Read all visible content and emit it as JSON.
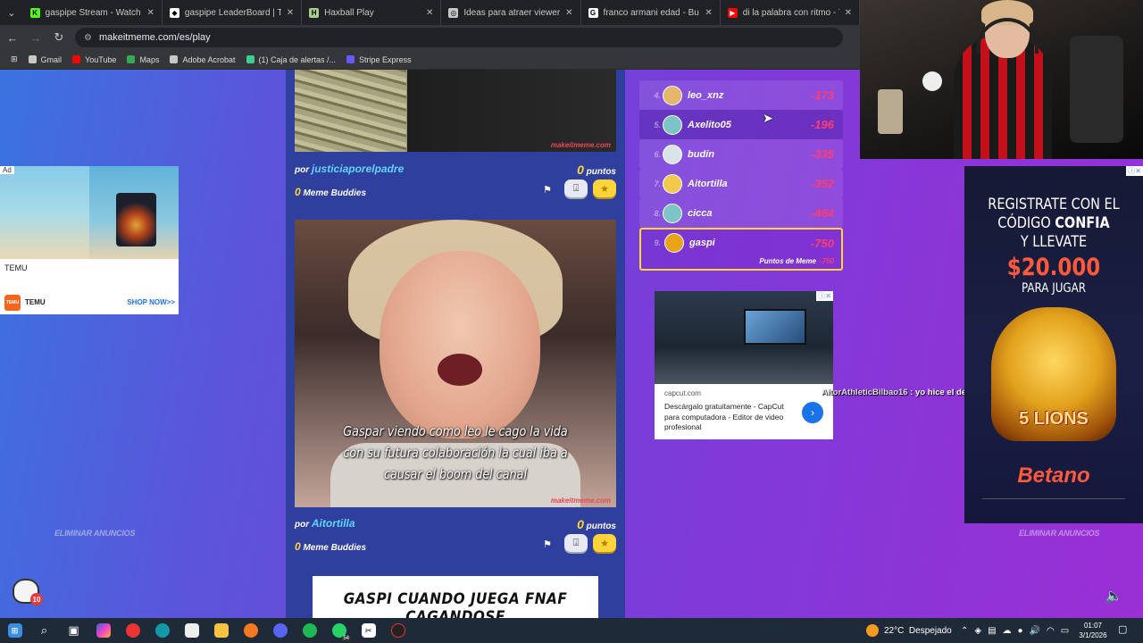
{
  "tabs": [
    {
      "label": "gaspipe Stream - Watch Live on",
      "color": "#53fc18",
      "glyph": "K",
      "active": false
    },
    {
      "label": "gaspipe LeaderBoard | The best",
      "color": "#ffffff",
      "glyph": "◆",
      "active": false
    },
    {
      "label": "Haxball Play",
      "color": "#a7cf8b",
      "glyph": "H",
      "active": false
    },
    {
      "label": "Ideas para atraer viewers",
      "color": "#c8c8c8",
      "glyph": "◎",
      "active": false
    },
    {
      "label": "franco armani edad - Buscar con",
      "color": "#ffffff",
      "glyph": "G",
      "active": false
    },
    {
      "label": "di la palabra con ritmo - YouTu",
      "color": "#ff0000",
      "glyph": "▶",
      "active": false
    }
  ],
  "address": {
    "url": "makeitmeme.com/es/play"
  },
  "bookmarks": [
    {
      "label": "Gmail",
      "color": "#c8c8c8"
    },
    {
      "label": "YouTube",
      "color": "#ff0000"
    },
    {
      "label": "Maps",
      "color": "#34a853"
    },
    {
      "label": "Adobe Acrobat",
      "color": "#c8c8c8"
    },
    {
      "label": "(1) Caja de alertas /...",
      "color": "#3ccf91"
    },
    {
      "label": "Stripe Express",
      "color": "#635bff"
    }
  ],
  "feed": {
    "post1": {
      "by_prefix": "por",
      "author": "justiciaporelpadre",
      "points": "0",
      "points_label": "puntos",
      "buddies": "0",
      "buddies_label": "Meme Buddies",
      "watermark": "makeitmeme.com"
    },
    "post2": {
      "caption": "Gaspar viendo como leo le cago la vida con su futura colaboración la cual iba a causar el boom del canal",
      "by_prefix": "por",
      "author": "Aitortilla",
      "points": "0",
      "points_label": "puntos",
      "buddies": "0",
      "buddies_label": "Meme Buddies",
      "watermark": "makeitmeme.com"
    },
    "post3": {
      "caption": "GASPI CUANDO JUEGA FNAF CAGANDOSE"
    }
  },
  "leaderboard": {
    "rows": [
      {
        "rank": "4.",
        "name": "leo_xnz",
        "score": "-173"
      },
      {
        "rank": "5.",
        "name": "Axelito05",
        "score": "-196"
      },
      {
        "rank": "6.",
        "name": "budín",
        "score": "-335"
      },
      {
        "rank": "7.",
        "name": "Aitortilla",
        "score": "-352"
      },
      {
        "rank": "8.",
        "name": "cicca",
        "score": "-464"
      }
    ],
    "me": {
      "rank": "9.",
      "name": "gaspi",
      "score": "-750",
      "meme_label": "Puntos de Meme",
      "meme_value": "-750"
    }
  },
  "ads": {
    "temu": {
      "tag": "Ad",
      "brand": "TEMU",
      "logo_name": "TEMU",
      "cta": "SHOP NOW>>",
      "logo_text": "TEMU"
    },
    "remove_left": "ELIMINAR ANUNCIOS",
    "remove_right": "ELIMINAR ANUNCIOS",
    "capcut": {
      "domain": "capcut.com",
      "description": "Descárgalo gratuitamente - CapCut para computadora - Editor de video profesional"
    },
    "betano": {
      "line1": "REGISTRATE CON EL",
      "line2a": "CÓDIGO ",
      "line2b": "CONFIA",
      "line3": "Y LLEVATE",
      "amount": "$20.000",
      "para": "PARA JUGAR",
      "game": "5 LIONS",
      "brand": "Betano"
    }
  },
  "chat": {
    "user": "AitorAthleticBilbao16",
    "message": " : yo hice el de Leo"
  },
  "notif_badge": "10",
  "taskbar": {
    "weather_temp": "22°C",
    "weather_desc": "Despejado",
    "time": "01:07",
    "date": "3/1/2026",
    "whatsapp_count": "54"
  }
}
